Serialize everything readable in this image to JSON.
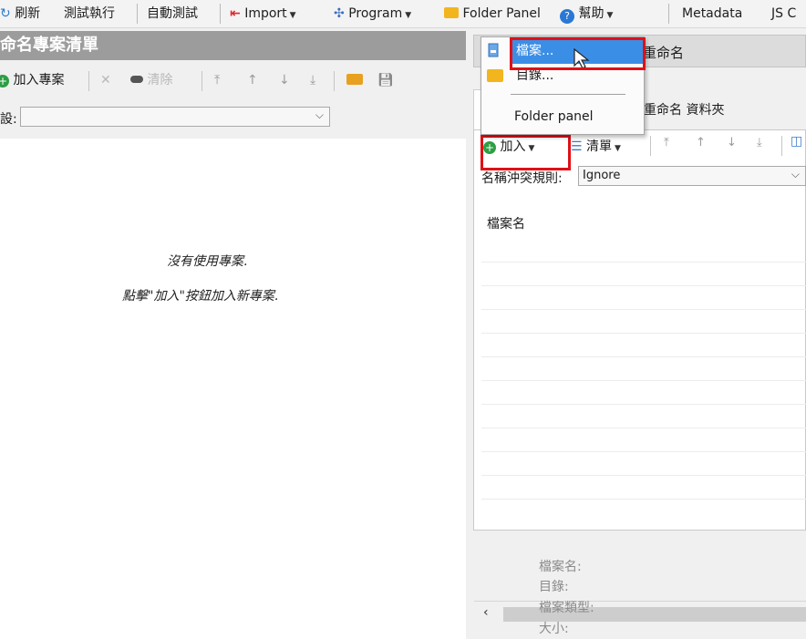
{
  "menu": {
    "refresh": "刷新",
    "test_run": "測試執行",
    "auto_test": "自動測試",
    "import": "Import",
    "program": "Program",
    "folder_panel": "Folder Panel",
    "help": "幫助",
    "metadata": "Metadata",
    "js": "JS C"
  },
  "left_panel": {
    "title": "命名專案清單",
    "toolbar": {
      "add_project": "加入專案",
      "clear": "清除"
    },
    "preset_label": "設:",
    "empty_line1": "沒有使用專案.",
    "empty_line2": "點擊\"加入\"按鈕加入新專案."
  },
  "right_panel": {
    "header_rename": "重命名",
    "tab_rename_folder": "重命名 資料夾",
    "add_button": "加入",
    "list_button": "清單",
    "conflict_label": "名稱沖突規則:",
    "conflict_value": "Ignore",
    "column_filename": "檔案名",
    "info": {
      "filename": "檔案名:",
      "directory": "目錄:",
      "filetype": "檔案類型:",
      "size": "大小:"
    }
  },
  "dropdown": {
    "files": "檔案...",
    "directory": "目錄...",
    "folder_panel": "Folder panel"
  },
  "colors": {
    "accent": "#3b8ee6",
    "highlight_box": "#e01016",
    "header_gray": "#9c9c9c"
  }
}
